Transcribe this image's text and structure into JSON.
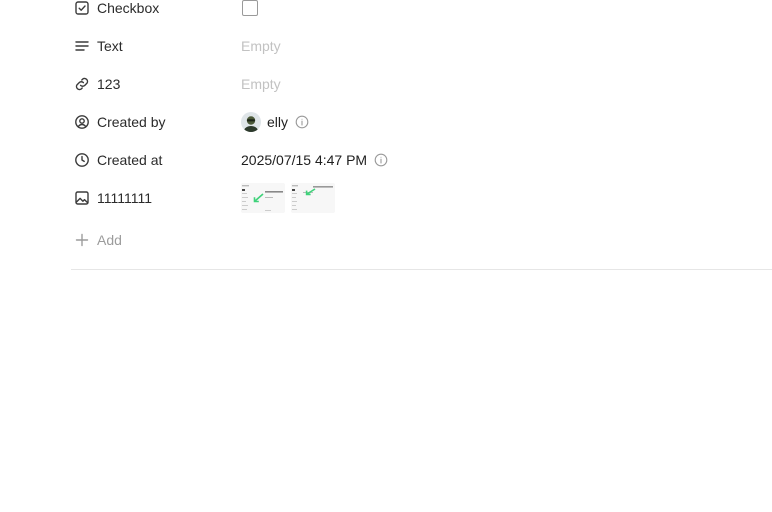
{
  "properties": [
    {
      "label": "Checkbox",
      "icon": "checkbox-icon",
      "value_type": "checkbox",
      "checked": false
    },
    {
      "label": "Text",
      "icon": "text-lines-icon",
      "value_type": "empty",
      "value": "Empty"
    },
    {
      "label": "123",
      "icon": "link-icon",
      "value_type": "empty",
      "value": "Empty"
    },
    {
      "label": "Created by",
      "icon": "user-circle-icon",
      "value_type": "user",
      "value": "elly"
    },
    {
      "label": "Created at",
      "icon": "clock-icon",
      "value_type": "datetime",
      "value": "2025/07/15 4:47 PM"
    },
    {
      "label": "11111111",
      "icon": "image-icon",
      "value_type": "images",
      "image_count": 2
    }
  ],
  "add": {
    "label": "Add",
    "icon": "plus-icon"
  },
  "colors": {
    "muted": "#c2c2c2",
    "accent_arrow": "#3fd27a",
    "divider": "#e6e6e6"
  }
}
